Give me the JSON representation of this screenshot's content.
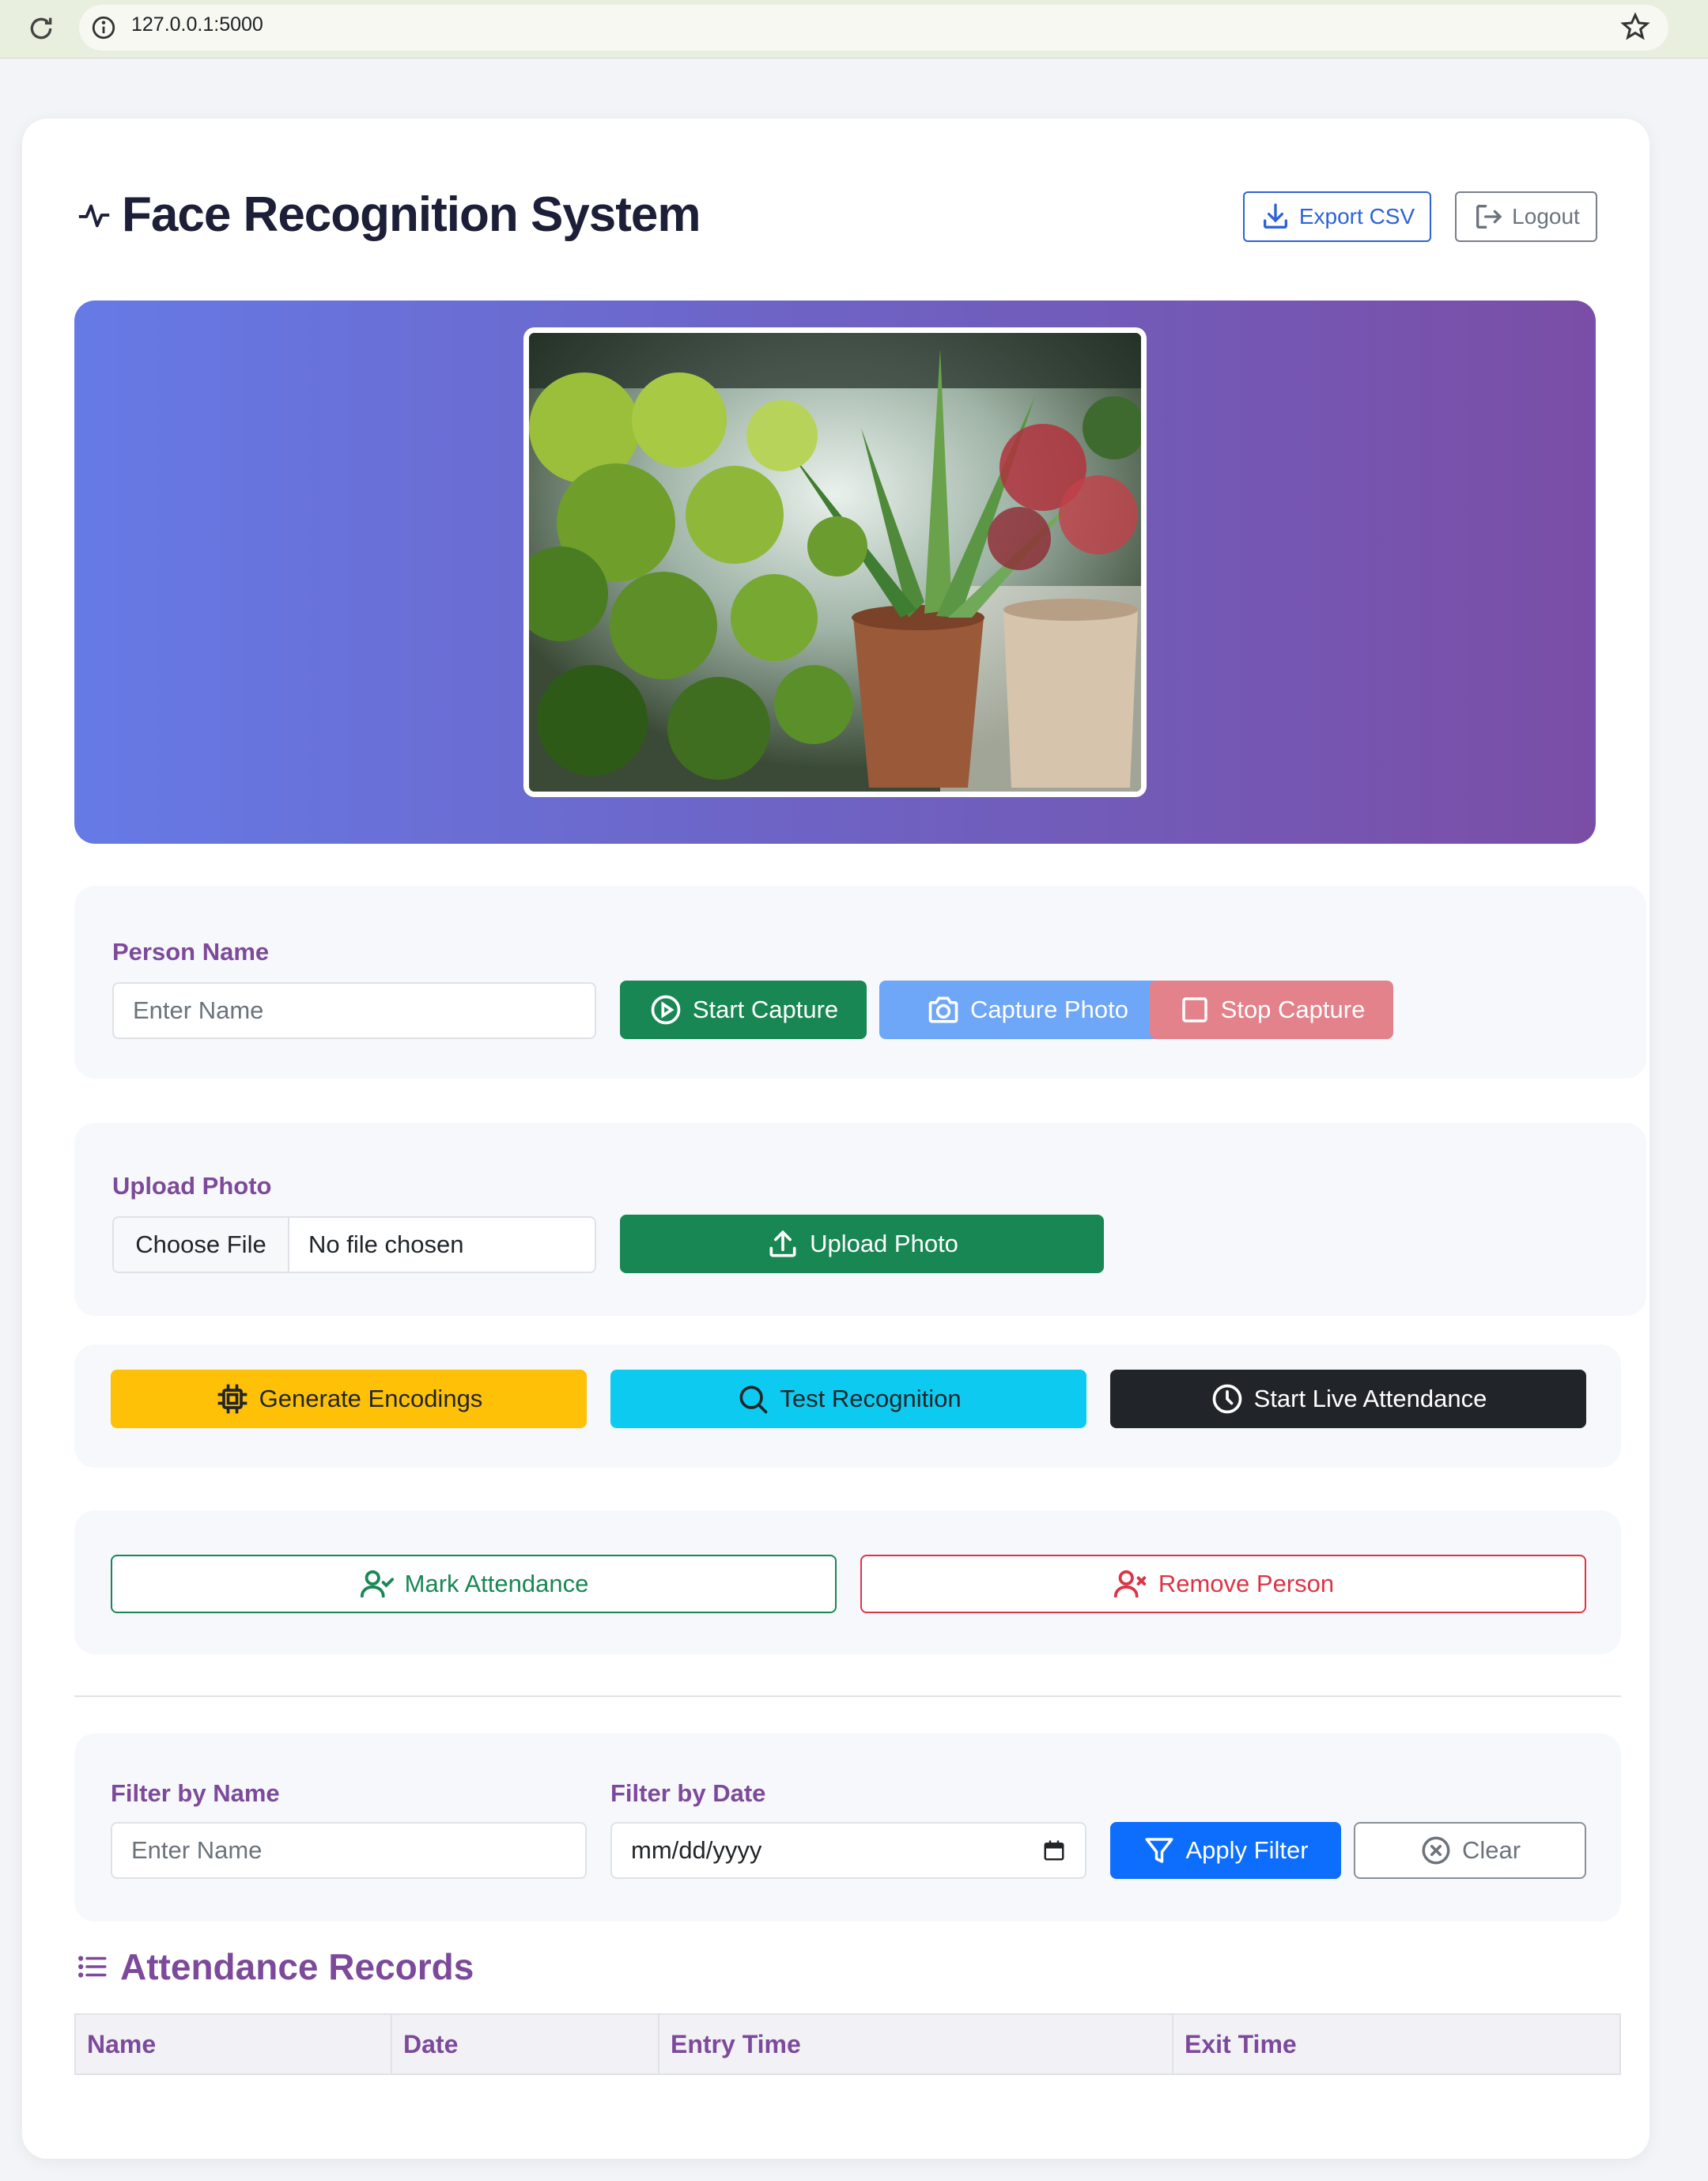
{
  "browser": {
    "url": "127.0.0.1:5000"
  },
  "header": {
    "title": "Face Recognition System",
    "export_label": "Export CSV",
    "logout_label": "Logout"
  },
  "capture": {
    "label": "Person Name",
    "placeholder": "Enter Name",
    "start_label": "Start Capture",
    "photo_label": "Capture Photo",
    "stop_label": "Stop Capture"
  },
  "upload": {
    "label": "Upload Photo",
    "choose_label": "Choose File",
    "no_file_text": "No file chosen",
    "upload_label": "Upload Photo"
  },
  "actions": {
    "generate_label": "Generate Encodings",
    "test_label": "Test Recognition",
    "live_label": "Start Live Attendance",
    "mark_label": "Mark Attendance",
    "remove_label": "Remove Person"
  },
  "filter": {
    "name_label": "Filter by Name",
    "name_placeholder": "Enter Name",
    "date_label": "Filter by Date",
    "date_placeholder": "mm/dd/yyyy",
    "apply_label": "Apply Filter",
    "clear_label": "Clear"
  },
  "records": {
    "title": "Attendance Records",
    "columns": [
      "Name",
      "Date",
      "Entry Time",
      "Exit Time"
    ]
  },
  "colors": {
    "accent_purple": "#7d4a9b",
    "success": "#198754",
    "info": "#0dcaf0",
    "warning": "#ffc107",
    "danger": "#dc3545",
    "primary": "#0d6efd",
    "dark": "#212529"
  }
}
